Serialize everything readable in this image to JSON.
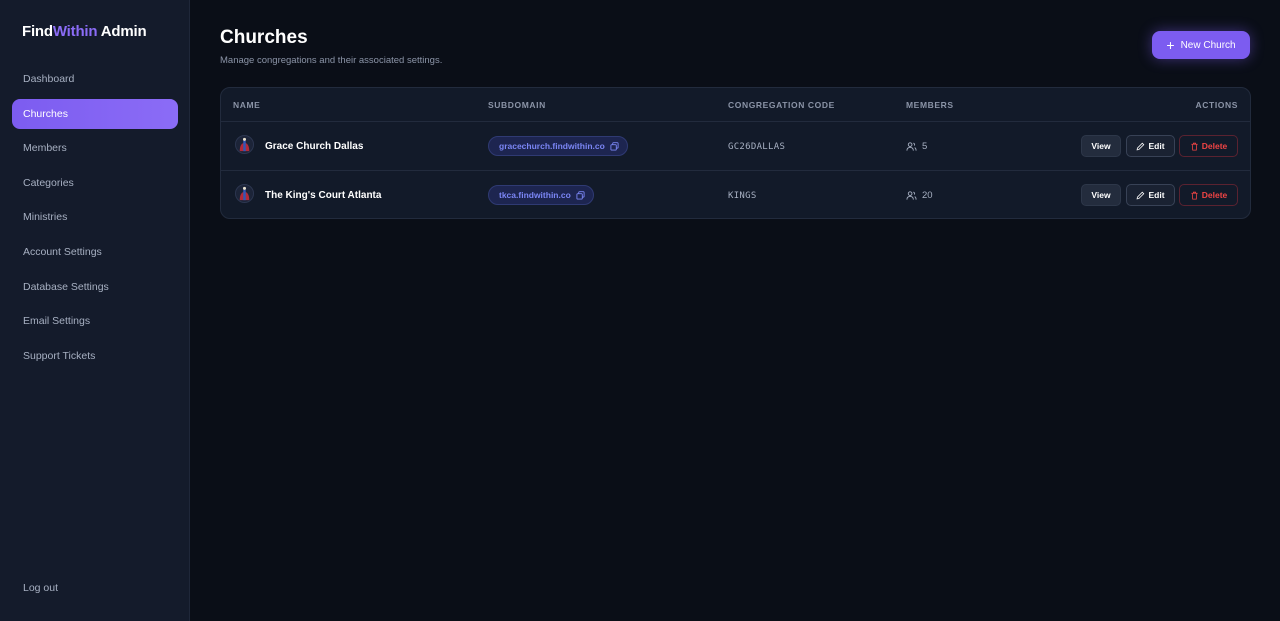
{
  "brand": {
    "part1": "Find",
    "part2": "Within",
    "part3": " Admin"
  },
  "sidebar": {
    "items": [
      {
        "label": "Dashboard",
        "active": false
      },
      {
        "label": "Churches",
        "active": true
      },
      {
        "label": "Members",
        "active": false
      },
      {
        "label": "Categories",
        "active": false
      },
      {
        "label": "Ministries",
        "active": false
      },
      {
        "label": "Account Settings",
        "active": false
      },
      {
        "label": "Database Settings",
        "active": false
      },
      {
        "label": "Email Settings",
        "active": false
      },
      {
        "label": "Support Tickets",
        "active": false
      }
    ],
    "logout_label": "Log out"
  },
  "page": {
    "title": "Churches",
    "subtitle": "Manage congregations and their associated settings.",
    "new_button_label": "New Church"
  },
  "table": {
    "headers": {
      "name": "NAME",
      "subdomain": "SUBDOMAIN",
      "code": "CONGREGATION CODE",
      "members": "MEMBERS",
      "actions": "ACTIONS"
    },
    "rows": [
      {
        "name": "Grace Church Dallas",
        "subdomain": "gracechurch.findwithin.co",
        "code": "GC26DALLAS",
        "members": "5"
      },
      {
        "name": "The King's Court Atlanta",
        "subdomain": "tkca.findwithin.co",
        "code": "KINGS",
        "members": "20"
      }
    ],
    "actions": {
      "view": "View",
      "edit": "Edit",
      "delete": "Delete"
    }
  },
  "colors": {
    "accent": "#7c5cf0",
    "background": "#0a0e17",
    "sidebar": "#141b2b",
    "danger": "#ef4444",
    "link": "#7b86f5"
  },
  "icons": {
    "new": "plus-icon",
    "copy": "copy-icon",
    "members": "users-icon",
    "edit": "pencil-icon",
    "delete": "trash-icon",
    "avatar": "church-logo-icon"
  }
}
